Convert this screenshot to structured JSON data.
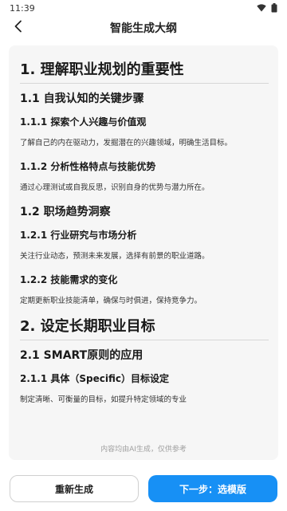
{
  "status_bar": {
    "time": "11:39",
    "icons": [
      "wifi-icon",
      "battery-icon"
    ]
  },
  "app_bar": {
    "title": "智能生成大纲",
    "back_icon": "chevron-left-icon"
  },
  "outline": {
    "sections": [
      {
        "title": "1. 理解职业规划的重要性",
        "subsections": [
          {
            "title": "1.1 自我认知的关键步骤",
            "items": [
              {
                "title": "1.1.1 探索个人兴趣与价值观",
                "text": "了解自己的内在驱动力，发掘潜在的兴趣领域，明确生活目标。"
              },
              {
                "title": "1.1.2 分析性格特点与技能优势",
                "text": "通过心理测试或自我反思，识别自身的优势与潜力所在。"
              }
            ]
          },
          {
            "title": "1.2 职场趋势洞察",
            "items": [
              {
                "title": "1.2.1 行业研究与市场分析",
                "text": "关注行业动态，预测未来发展，选择有前景的职业道路。"
              },
              {
                "title": "1.2.2 技能需求的变化",
                "text": "定期更新职业技能清单，确保与时俱进，保持竞争力。"
              }
            ]
          }
        ]
      },
      {
        "title": "2. 设定长期职业目标",
        "subsections": [
          {
            "title": "2.1 SMART原则的应用",
            "items": [
              {
                "title": "2.1.1 具体（Specific）目标设定",
                "text": "制定清晰、可衡量的目标，如提升特定领域的专业"
              }
            ]
          }
        ]
      }
    ]
  },
  "disclaimer": "内容均由AI生成，仅供参考",
  "buttons": {
    "regenerate": "重新生成",
    "next": "下一步：选模版"
  },
  "colors": {
    "primary": "#1790f5",
    "card_bg": "#f6f6f6"
  }
}
